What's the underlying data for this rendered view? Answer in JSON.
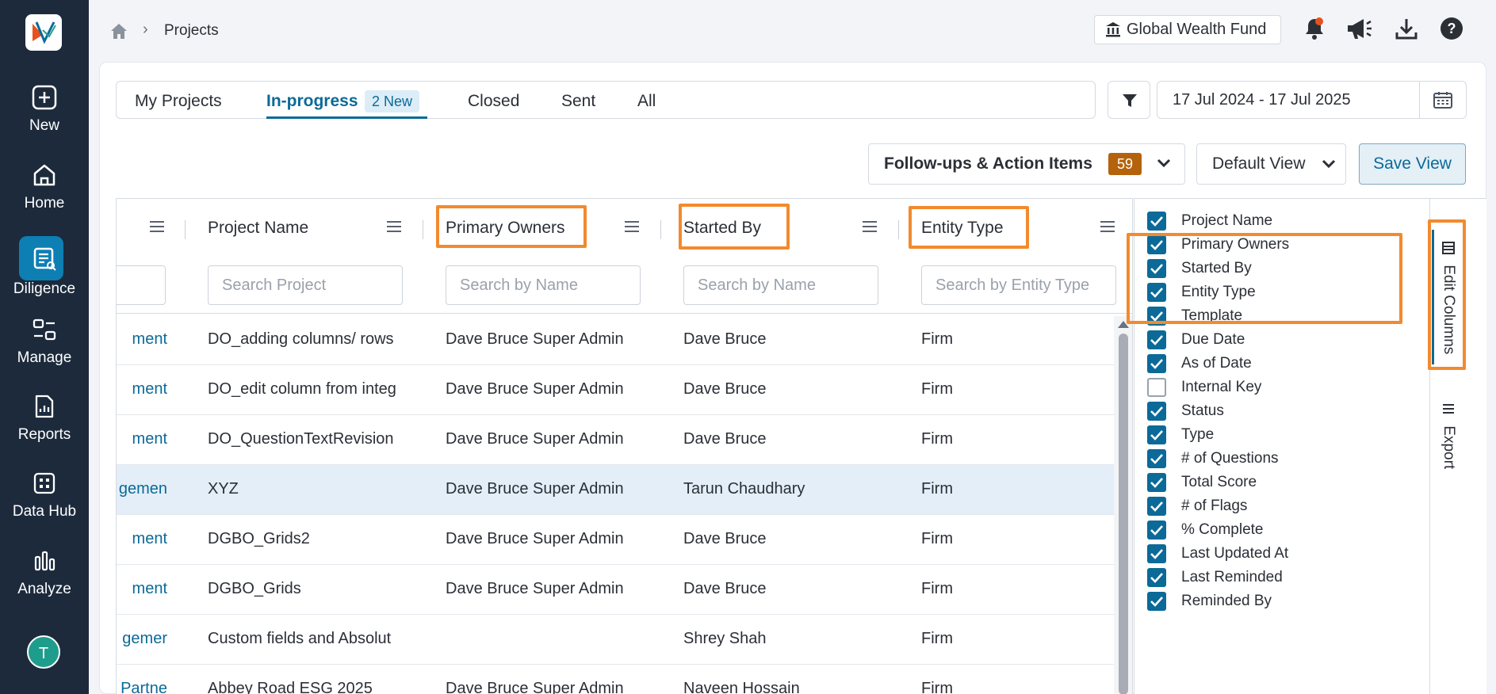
{
  "sidebar": {
    "items": [
      {
        "label": "New",
        "icon": "plus-square-icon"
      },
      {
        "label": "Home",
        "icon": "home-icon"
      },
      {
        "label": "Diligence",
        "icon": "diligence-icon"
      },
      {
        "label": "Manage",
        "icon": "manage-icon"
      },
      {
        "label": "Reports",
        "icon": "reports-icon"
      },
      {
        "label": "Data Hub",
        "icon": "data-hub-icon"
      },
      {
        "label": "Analyze",
        "icon": "bar-chart-icon"
      }
    ],
    "avatar_initial": "T"
  },
  "breadcrumb": {
    "current": "Projects"
  },
  "header": {
    "fund": "Global Wealth Fund"
  },
  "tabs": [
    {
      "label": "My Projects"
    },
    {
      "label": "In-progress",
      "badge": "2 New"
    },
    {
      "label": "Closed"
    },
    {
      "label": "Sent"
    },
    {
      "label": "All"
    }
  ],
  "date_range": "17 Jul 2024 - 17 Jul 2025",
  "toolbar": {
    "followups_label": "Follow-ups & Action Items",
    "followups_count": "59",
    "view_label": "Default View",
    "save_label": "Save View"
  },
  "grid": {
    "columns": [
      {
        "title": "Project Name",
        "placeholder": "Search Project"
      },
      {
        "title": "Primary Owners",
        "placeholder": "Search by Name"
      },
      {
        "title": "Started By",
        "placeholder": "Search by Name"
      },
      {
        "title": "Entity Type",
        "placeholder": "Search by Entity Type"
      }
    ],
    "rows": [
      {
        "lead": "ment",
        "project": "DO_adding columns/ rows",
        "owners": "Dave Bruce Super Admin",
        "started": "Dave Bruce",
        "entity": "Firm"
      },
      {
        "lead": "ment",
        "project": "DO_edit column from integ",
        "owners": "Dave Bruce Super Admin",
        "started": "Dave Bruce",
        "entity": "Firm"
      },
      {
        "lead": "ment",
        "project": "DO_QuestionTextRevision",
        "owners": "Dave Bruce Super Admin",
        "started": "Dave Bruce",
        "entity": "Firm"
      },
      {
        "lead": "gemen",
        "project": "XYZ",
        "owners": "Dave Bruce Super Admin",
        "started": "Tarun Chaudhary",
        "entity": "Firm",
        "selected": true
      },
      {
        "lead": "ment",
        "project": "DGBO_Grids2",
        "owners": "Dave Bruce Super Admin",
        "started": "Dave Bruce",
        "entity": "Firm"
      },
      {
        "lead": "ment",
        "project": "DGBO_Grids",
        "owners": "Dave Bruce Super Admin",
        "started": "Dave Bruce",
        "entity": "Firm"
      },
      {
        "lead": "gemer",
        "project": "Custom fields and Absolut",
        "owners": "",
        "started": "Shrey Shah",
        "entity": "Firm"
      },
      {
        "lead": "Partne",
        "project": "Abbey Road ESG 2025",
        "owners": "Dave Bruce Super Admin",
        "started": "Naveen Hossain",
        "entity": "Firm"
      }
    ]
  },
  "column_panel": {
    "items": [
      {
        "label": "Project Name",
        "checked": true
      },
      {
        "label": "Primary Owners",
        "checked": true
      },
      {
        "label": "Started By",
        "checked": true
      },
      {
        "label": "Entity Type",
        "checked": true
      },
      {
        "label": "Template",
        "checked": true
      },
      {
        "label": "Due Date",
        "checked": true
      },
      {
        "label": "As of Date",
        "checked": true
      },
      {
        "label": "Internal Key",
        "checked": false
      },
      {
        "label": "Status",
        "checked": true
      },
      {
        "label": "Type",
        "checked": true
      },
      {
        "label": "# of Questions",
        "checked": true
      },
      {
        "label": "Total Score",
        "checked": true
      },
      {
        "label": "# of Flags",
        "checked": true
      },
      {
        "label": "% Complete",
        "checked": true
      },
      {
        "label": "Last Updated At",
        "checked": true
      },
      {
        "label": "Last Reminded",
        "checked": true
      },
      {
        "label": "Reminded By",
        "checked": true
      }
    ]
  },
  "side_tabs": {
    "edit_columns": "Edit Columns",
    "export": "Export"
  },
  "colors": {
    "accent": "#0b6a98",
    "sidebar": "#1c2a3c",
    "highlight": "#f28a2e",
    "count_badge": "#b4630c"
  }
}
